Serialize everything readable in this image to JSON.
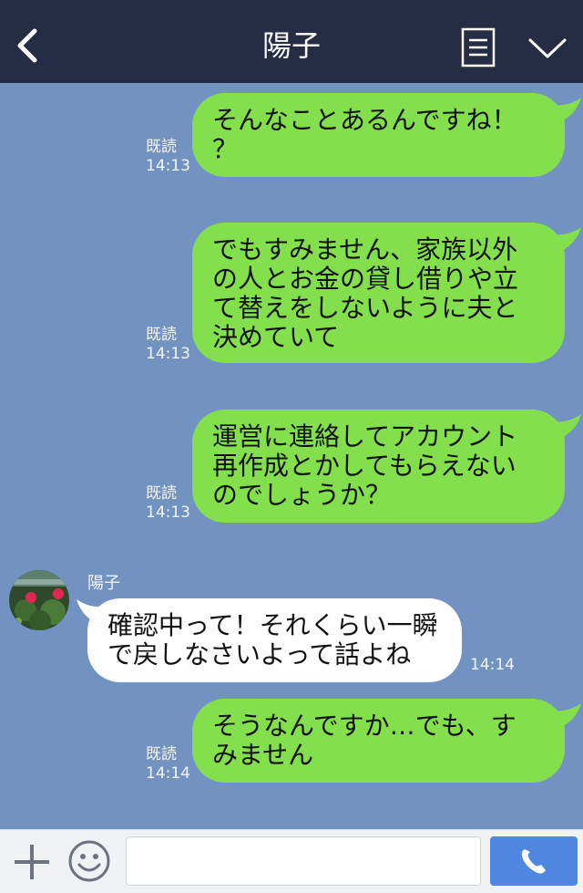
{
  "header": {
    "title": "陽子"
  },
  "messages": [
    {
      "read": "既読",
      "time": "14:13",
      "text": "そんなことあるんですね！\n？"
    },
    {
      "read": "既読",
      "time": "14:13",
      "text": "でもすみません、家族以外\nの人とお金の貸し借りや立\nて替えをしないように夫と\n決めていて"
    },
    {
      "read": "既読",
      "time": "14:13",
      "text": "運営に連絡してアカウント\n再作成とかしてもらえない\nのでしょうか？"
    },
    {
      "sender": "陽子",
      "time": "14:14",
      "text": "確認中って！それくらい一瞬\nで戻しなさいよって話よね"
    },
    {
      "read": "既読",
      "time": "14:14",
      "text": "そうなんですか…でも、す\nみません"
    }
  ],
  "footer": {
    "input_placeholder": ""
  },
  "icons": [
    "back-chevron-icon",
    "menu-list-icon",
    "chevron-down-icon",
    "plus-icon",
    "smile-icon",
    "phone-icon"
  ]
}
